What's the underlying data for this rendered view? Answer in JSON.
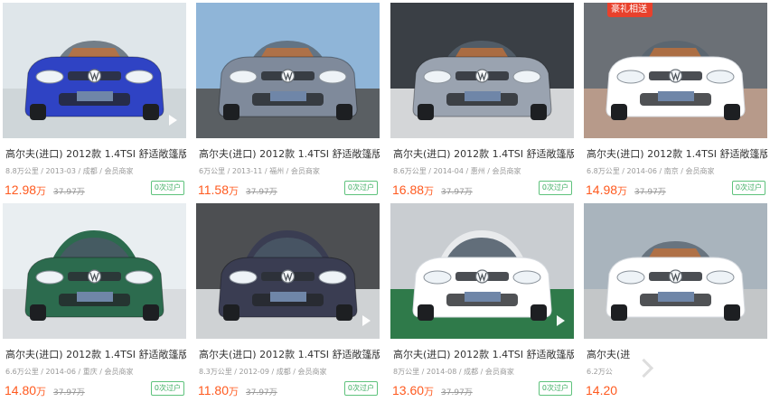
{
  "listings": [
    {
      "title": "高尔夫(进口) 2012款 1.4TSI 舒适敞篷版",
      "mileage": "8.8万公里",
      "date": "2013-03",
      "city": "成都",
      "seller": "会员商家",
      "price": "12.98",
      "unit": "万",
      "original": "37.97万",
      "transfer": "0次过户",
      "paint": "#2f43c4",
      "scene": "#dfe6ea",
      "ground": "#cfd6d9",
      "top": "open",
      "play": true,
      "badge": ""
    },
    {
      "title": "高尔夫(进口) 2012款 1.4TSI 舒适敞篷版",
      "mileage": "6万公里",
      "date": "2013-11",
      "city": "福州",
      "seller": "会员商家",
      "price": "11.58",
      "unit": "万",
      "original": "37.97万",
      "transfer": "0次过户",
      "paint": "#7f8a9b",
      "scene": "#8fb5d8",
      "ground": "#5a5f63",
      "top": "open",
      "play": false,
      "badge": ""
    },
    {
      "title": "高尔夫(进口) 2012款 1.4TSI 舒适敞篷版",
      "mileage": "8.6万公里",
      "date": "2014-04",
      "city": "惠州",
      "seller": "会员商家",
      "price": "16.88",
      "unit": "万",
      "original": "37.97万",
      "transfer": "0次过户",
      "paint": "#9aa3b0",
      "scene": "#3a3f45",
      "ground": "#d4d6d8",
      "top": "open",
      "play": false,
      "badge": ""
    },
    {
      "title": "高尔夫(进口) 2012款 1.4TSI 舒适敞篷版",
      "mileage": "6.8万公里",
      "date": "2014-06",
      "city": "南京",
      "seller": "会员商家",
      "price": "14.98",
      "unit": "万",
      "original": "37.97万",
      "transfer": "0次过户",
      "paint": "#ffffff",
      "scene": "#6b7076",
      "ground": "#b79a8a",
      "top": "open",
      "play": false,
      "badge": "豪礼相送"
    },
    {
      "title": "高尔夫(进口) 2012款 1.4TSI 舒适敞篷版",
      "mileage": "6.6万公里",
      "date": "2014-06",
      "city": "重庆",
      "seller": "会员商家",
      "price": "14.80",
      "unit": "万",
      "original": "37.97万",
      "transfer": "0次过户",
      "paint": "#2c6b4e",
      "scene": "#e9eef1",
      "ground": "#d9dcdf",
      "top": "closed",
      "play": false,
      "badge": ""
    },
    {
      "title": "高尔夫(进口) 2012款 1.4TSI 舒适敞篷版",
      "mileage": "8.3万公里",
      "date": "2012-09",
      "city": "成都",
      "seller": "会员商家",
      "price": "11.80",
      "unit": "万",
      "original": "37.97万",
      "transfer": "0次过户",
      "paint": "#3a3d52",
      "scene": "#4d4f52",
      "ground": "#cfd2d4",
      "top": "closed",
      "play": true,
      "badge": ""
    },
    {
      "title": "高尔夫(进口) 2012款 1.4TSI 舒适敞篷版",
      "mileage": "8万公里",
      "date": "2014-08",
      "city": "成都",
      "seller": "会员商家",
      "price": "13.60",
      "unit": "万",
      "original": "37.97万",
      "transfer": "0次过户",
      "paint": "#ffffff",
      "scene": "#c9cdd1",
      "ground": "#2f7a4a",
      "top": "closed",
      "play": true,
      "badge": ""
    },
    {
      "title": "高尔夫(进",
      "mileage": "6.2万公",
      "date": "",
      "city": "",
      "seller": "",
      "price": "14.20",
      "unit": "",
      "original": "",
      "transfer": "",
      "paint": "#ffffff",
      "scene": "#a9b4bd",
      "ground": "#c3c6c8",
      "top": "open",
      "play": false,
      "badge": ""
    }
  ]
}
